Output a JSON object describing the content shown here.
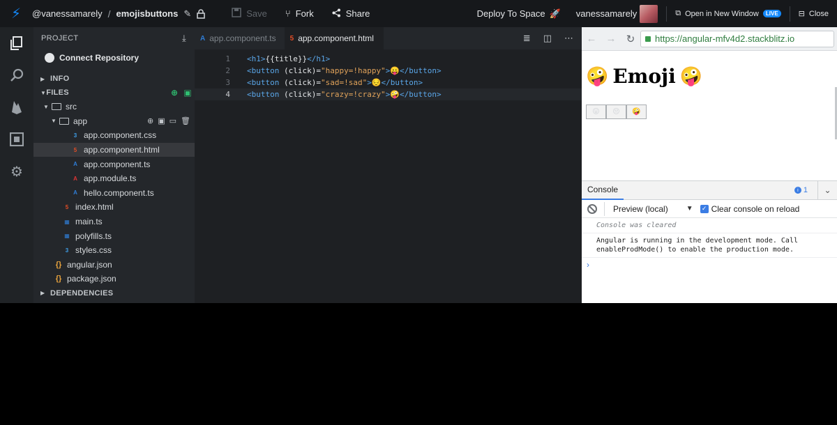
{
  "topbar": {
    "user_path": "@vanessamarely",
    "separator": "/",
    "project_name": "emojisbuttons",
    "save_label": "Save",
    "fork_label": "Fork",
    "share_label": "Share",
    "deploy_label": "Deploy To Space",
    "username": "vanessamarely",
    "open_window_label": "Open in New Window",
    "live_badge": "LIVE",
    "close_label": "Close"
  },
  "sidebar": {
    "project_label": "PROJECT",
    "connect_label": "Connect Repository",
    "info_label": "INFO",
    "files_label": "FILES",
    "dependencies_label": "DEPENDENCIES",
    "tree": [
      {
        "name": "src",
        "type": "folder"
      },
      {
        "name": "app",
        "type": "folder"
      },
      {
        "name": "app.component.css",
        "type": "css"
      },
      {
        "name": "app.component.html",
        "type": "html"
      },
      {
        "name": "app.component.ts",
        "type": "ng"
      },
      {
        "name": "app.module.ts",
        "type": "ngr"
      },
      {
        "name": "hello.component.ts",
        "type": "ng"
      },
      {
        "name": "index.html",
        "type": "html"
      },
      {
        "name": "main.ts",
        "type": "ts"
      },
      {
        "name": "polyfills.ts",
        "type": "ts"
      },
      {
        "name": "styles.css",
        "type": "css"
      },
      {
        "name": "angular.json",
        "type": "json"
      },
      {
        "name": "package.json",
        "type": "json"
      }
    ]
  },
  "editor": {
    "tabs": [
      "app.component.ts",
      "app.component.html"
    ],
    "line_numbers": [
      "1",
      "2",
      "3",
      "4"
    ],
    "lines": [
      {
        "t1": "<h1>",
        "a": "{{title}}",
        "t2": "</h1>"
      },
      {
        "t1": "<button",
        "a": " (click)=",
        "s": "\"happy=!happy\"",
        "t2": ">😛</button>"
      },
      {
        "t1": "<button",
        "a": " (click)=",
        "s": "\"sad=!sad\"",
        "t2": ">😔</button>"
      },
      {
        "t1": "<button",
        "a": " (click)=",
        "s": "\"crazy=!crazy\"",
        "t2": ">🤪</button>"
      }
    ]
  },
  "preview": {
    "url": "https://angular-mfv4d2.stackblitz.io",
    "heading": "Emoji",
    "heading_emoji": "🤪",
    "buttons": [
      "😛",
      "😔",
      "🤪"
    ]
  },
  "console": {
    "tab_label": "Console",
    "info_count": "1",
    "context": "Preview (local)",
    "clear_on_reload": "Clear console on reload",
    "cleared_msg": "Console was cleared",
    "log_msg_line1": "Angular is running in the development mode. Call",
    "log_msg_line2": "enableProdMode() to enable the production mode.",
    "prompt": "›"
  },
  "colors": {
    "accent": "#1389fd",
    "editor_bg": "#1e2023",
    "sidebar_bg": "#24272b"
  }
}
